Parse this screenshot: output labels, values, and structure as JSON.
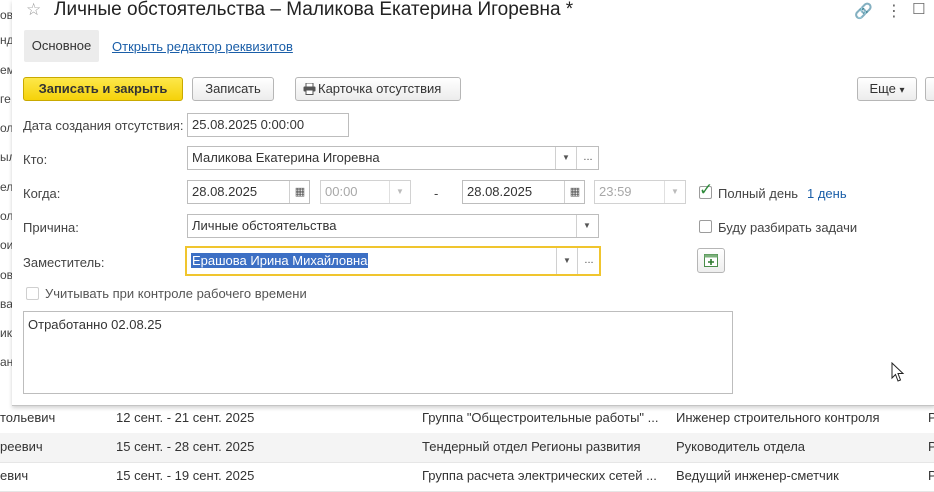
{
  "background": {
    "left_fragments": [
      "ов",
      "нд",
      "ем",
      "ге",
      "ол",
      "ыл",
      "ел",
      "ол",
      "ои",
      "ов",
      "ва",
      "ик",
      "ан"
    ],
    "rows": [
      {
        "name": "тольевич",
        "period": "12 сент. - 21 сент. 2025",
        "department": "Группа \"Общестроительные работы\" ...",
        "position": "Инженер строительного контроля",
        "extra": "Р"
      },
      {
        "name": "реевич",
        "period": "15 сент. - 28 сент. 2025",
        "department": "Тендерный отдел Регионы развития",
        "position": "Руководитель отдела",
        "extra": "Р"
      },
      {
        "name": "евич",
        "period": "15 сент. - 19 сент. 2025",
        "department": "Группа расчета электрических сетей ...",
        "position": "Ведущий инженер-сметчик",
        "extra": "Р"
      }
    ]
  },
  "dialog": {
    "title": "Личные обстоятельства – Маликова Екатерина Игоревна *",
    "star_icon": "☆",
    "link_icon": "🔗",
    "menu_icon": "⋮",
    "window_icon": "☐",
    "tabs": {
      "main": "Основное",
      "editor_link": "Открыть редактор реквизитов"
    },
    "toolbar": {
      "save_close": "Записать и закрыть",
      "save": "Записать",
      "absence_card": "Карточка отсутствия",
      "more": "Еще",
      "more_arrow": "▾"
    },
    "form": {
      "created_label": "Дата создания отсутствия:",
      "created_value": "25.08.2025  0:00:00",
      "who_label": "Кто:",
      "who_value": "Маликова Екатерина Игоревна",
      "when_label": "Когда:",
      "date_from": "28.08.2025",
      "time_from": "00:00",
      "dash": "-",
      "date_to": "28.08.2025",
      "time_to": "23:59",
      "full_day_label": "Полный день",
      "full_day_checked": true,
      "days_link": "1 день",
      "reason_label": "Причина:",
      "reason_value": "Личные обстоятельства",
      "tasks_label": "Буду разбирать задачи",
      "tasks_checked": false,
      "deputy_label": "Заместитель:",
      "deputy_value": "Ерашова Ирина Михайловна",
      "track_label": "Учитывать при контроле рабочего времени",
      "track_checked": false,
      "comment": "Отработанно 02.08.25",
      "dropdown_arrow": "▼",
      "dots": "...",
      "calendar_icon": "▦"
    }
  }
}
